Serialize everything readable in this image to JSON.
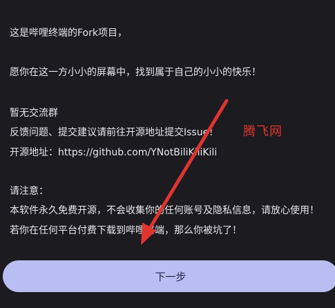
{
  "intro": {
    "line1": "这是哔哩终端的Fork项目，",
    "line2": "愿你在这一方小小的屏幕中，找到属于自己的小小的快乐！"
  },
  "info": {
    "no_group": "暂无交流群",
    "feedback": "反馈问题、提交建议请前往开源地址提交Issue！",
    "repo_prefix": "开源地址：",
    "repo_url": "https://github.com/YNotBiliKiliKili"
  },
  "notice": {
    "title": "请注意：",
    "line1": "本软件永久免费开源，不会收集你的任何账号及隐私信息，请放心使用！",
    "line2": "若你在任何平台付费下载到哔哩终端，那么你被坑了！"
  },
  "watermark": "腾飞网",
  "next_button": "下一步",
  "colors": {
    "background": "#1b1b20",
    "text": "#e8e6ee",
    "button": "#b9bef2",
    "button_text": "#23244a",
    "arrow": "#e0342f"
  }
}
